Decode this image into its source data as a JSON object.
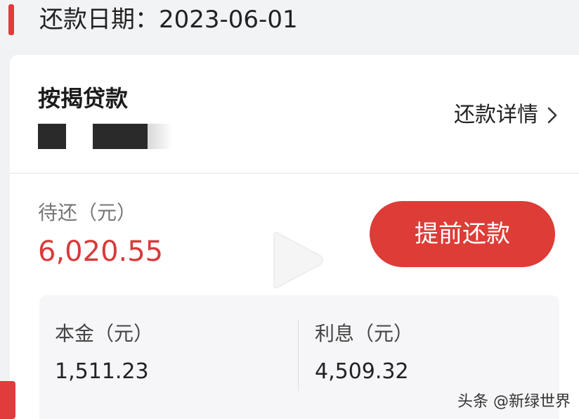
{
  "header": {
    "date_label": "还款日期：2023-06-01"
  },
  "loan": {
    "title": "按揭贷款",
    "detail_link_label": "还款详情",
    "detail_link_icon": "chevron-right-icon"
  },
  "pending": {
    "label": "待还（元）",
    "amount": "6,020.55"
  },
  "actions": {
    "prepay_label": "提前还款"
  },
  "breakdown": {
    "principal_label": "本金（元）",
    "principal_value": "1,511.23",
    "interest_label": "利息（元）",
    "interest_value": "4,509.32"
  },
  "overlay": {
    "icon": "play-icon"
  },
  "watermark": {
    "text": "头条 @新绿世界"
  },
  "colors": {
    "accent": "#de3c37",
    "amount": "#d93a3a",
    "background": "#f1f2f4",
    "card": "#ffffff"
  }
}
